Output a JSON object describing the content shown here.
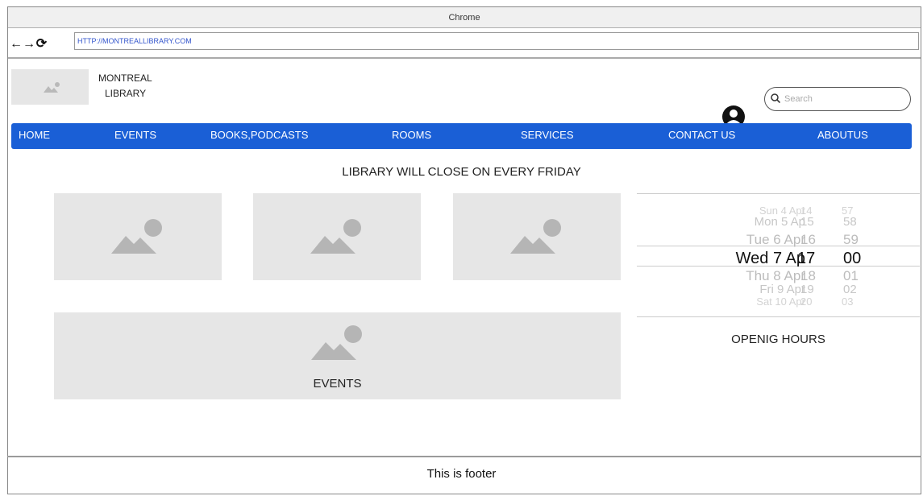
{
  "browser": {
    "title": "Chrome",
    "url": "HTTP://MONTREALLIBRARY.COM",
    "nav_icons": [
      "back-arrow-icon",
      "forward-arrow-icon",
      "reload-icon"
    ]
  },
  "header": {
    "logo_line1": "MONTREAL",
    "logo_line2": "LIBRARY",
    "search_placeholder": "Search"
  },
  "nav": {
    "items": [
      "HOME",
      "EVENTS",
      "BOOKS,PODCASTS",
      "ROOMS",
      "SERVICES",
      "CONTACT US",
      "ABOUTUS"
    ],
    "color": "#1a5fd6"
  },
  "banner": "LIBRARY WILL CLOSE ON EVERY FRIDAY",
  "events_label": "EVENTS",
  "picker": {
    "rows": [
      {
        "date": "Sun 4 Apr",
        "hour": "14",
        "minute": "57"
      },
      {
        "date": "Mon 5 Ap",
        "hour": "15",
        "minute": "58"
      },
      {
        "date": "Tue 6 Apr",
        "hour": "16",
        "minute": "59"
      },
      {
        "date": "Wed 7 Ap",
        "hour": "17",
        "minute": "00"
      },
      {
        "date": "Thu 8 Apr",
        "hour": "18",
        "minute": "01"
      },
      {
        "date": "Fri 9 Apr",
        "hour": "19",
        "minute": "02"
      },
      {
        "date": "Sat 10 Apr",
        "hour": "20",
        "minute": "03"
      }
    ],
    "selected_index": 3
  },
  "hours_label": "OPENIG HOURS",
  "footer": "This is footer"
}
